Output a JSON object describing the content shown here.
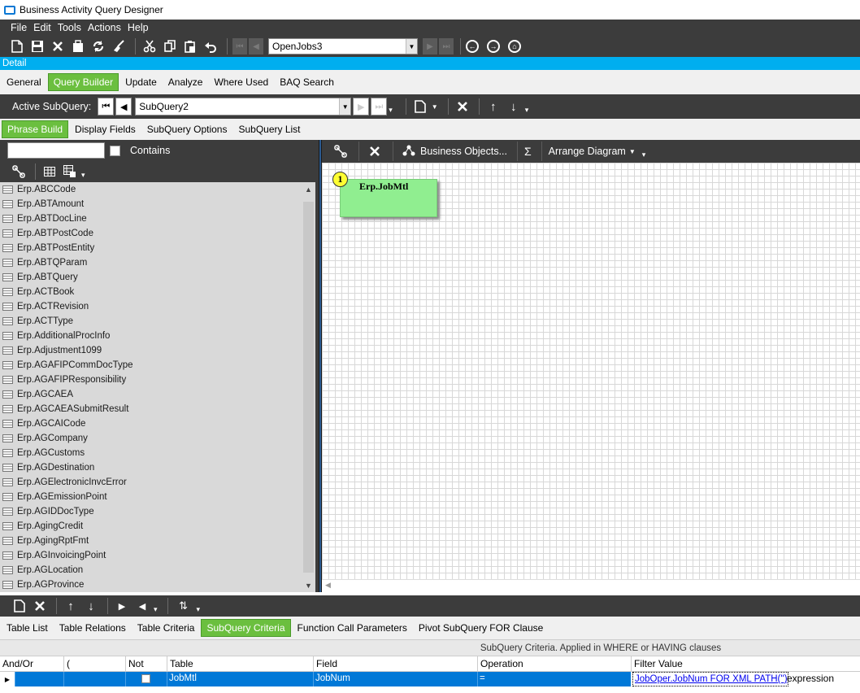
{
  "window": {
    "title": "Business Activity Query Designer"
  },
  "menu": [
    "File",
    "Edit",
    "Tools",
    "Actions",
    "Help"
  ],
  "toolbar": {
    "query_combo_value": "OpenJobs3",
    "icons": [
      "new-icon",
      "save-icon",
      "delete-icon",
      "attach-icon",
      "refresh-icon",
      "clear-icon",
      "cut-icon",
      "copy-icon",
      "paste-icon",
      "undo-icon"
    ]
  },
  "detail_label": "Detail",
  "main_tabs": [
    "General",
    "Query Builder",
    "Update",
    "Analyze",
    "Where Used",
    "BAQ Search"
  ],
  "subquery_bar": {
    "label": "Active SubQuery:",
    "value": "SubQuery2"
  },
  "phrase_tabs": [
    "Phrase Build",
    "Display Fields",
    "SubQuery Options",
    "SubQuery List"
  ],
  "search": {
    "value": "",
    "contains_label": "Contains"
  },
  "tables": [
    "Erp.ABCCode",
    "Erp.ABTAmount",
    "Erp.ABTDocLine",
    "Erp.ABTPostCode",
    "Erp.ABTPostEntity",
    "Erp.ABTQParam",
    "Erp.ABTQuery",
    "Erp.ACTBook",
    "Erp.ACTRevision",
    "Erp.ACTType",
    "Erp.AdditionalProcInfo",
    "Erp.Adjustment1099",
    "Erp.AGAFIPCommDocType",
    "Erp.AGAFIPResponsibility",
    "Erp.AGCAEA",
    "Erp.AGCAEASubmitResult",
    "Erp.AGCAICode",
    "Erp.AGCompany",
    "Erp.AGCustoms",
    "Erp.AGDestination",
    "Erp.AGElectronicInvcError",
    "Erp.AGEmissionPoint",
    "Erp.AGIDDocType",
    "Erp.AgingCredit",
    "Erp.AgingRptFmt",
    "Erp.AGInvoicingPoint",
    "Erp.AGLocation",
    "Erp.AGProvince"
  ],
  "diagram_toolbar": {
    "business_objects": "Business Objects...",
    "sigma": "Σ",
    "arrange": "Arrange Diagram"
  },
  "diagram": {
    "table_name": "Erp.JobMtl",
    "badge": "1"
  },
  "bottom_tabs": [
    "Table List",
    "Table Relations",
    "Table Criteria",
    "SubQuery Criteria",
    "Function Call Parameters",
    "Pivot SubQuery FOR Clause"
  ],
  "criteria": {
    "header": "SubQuery Criteria. Applied in WHERE or HAVING clauses",
    "columns": [
      "And/Or",
      "(",
      "Not",
      "Table",
      "Field",
      "Operation",
      "Filter Value"
    ],
    "row": {
      "andor": "",
      "paren": "",
      "table": "JobMtl",
      "field": "JobNum",
      "operation": "=",
      "filter_value": "JobOper.JobNum FOR XML PATH('')",
      "filter_type": "expression"
    }
  },
  "colors": {
    "dark_bar": "#3c3c3c",
    "accent_blue": "#00aeef",
    "active_tab_green": "#6bbf3f",
    "table_box": "#90ee90",
    "selected_row": "#0078d7"
  }
}
